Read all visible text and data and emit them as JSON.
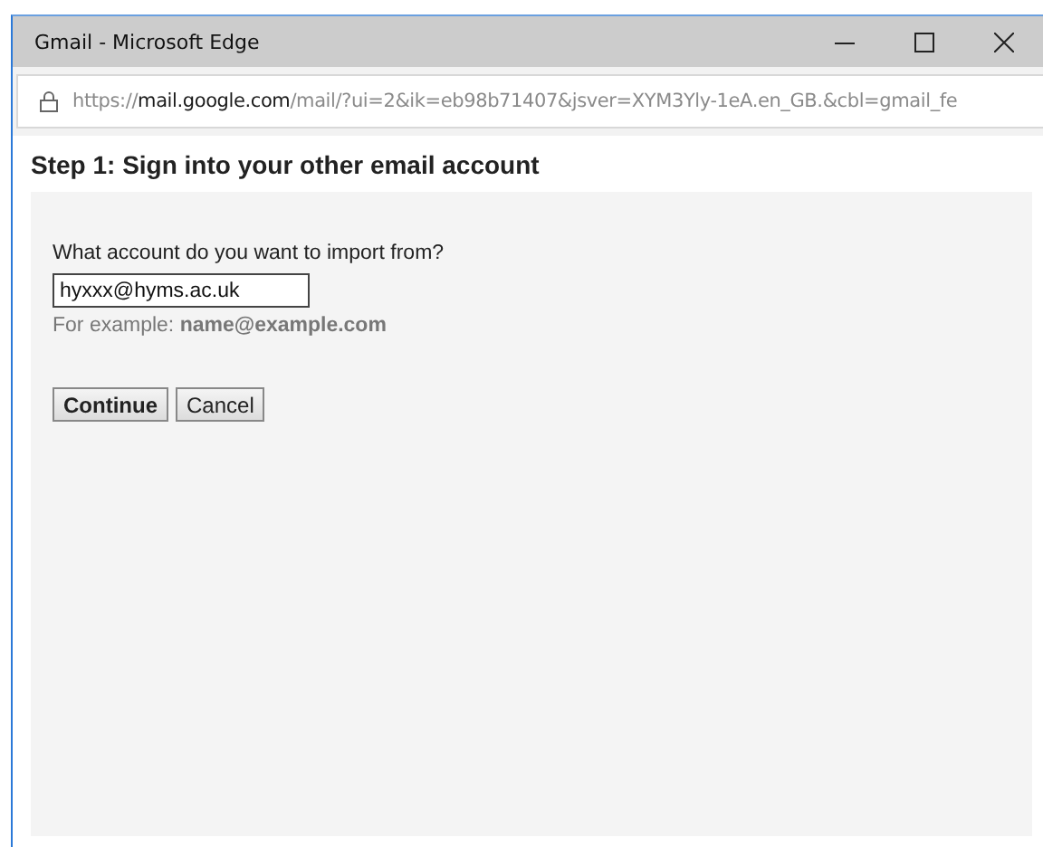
{
  "window": {
    "title": "Gmail - Microsoft Edge"
  },
  "address_bar": {
    "scheme": "https://",
    "host": "mail.google.com",
    "path": "/mail/?ui=2&ik=eb98b71407&jsver=XYM3Yly-1eA.en_GB.&cbl=gmail_fe"
  },
  "heading": "Step 1: Sign into your other email account",
  "form": {
    "label": "What account do you want to import from?",
    "value": "hyxxx@hyms.ac.uk",
    "hint": "For example: **name@example.com**"
  },
  "buttons": [
    {
      "label": "Continue",
      "kind": "primary"
    },
    {
      "label": "Cancel",
      "kind": "secondary"
    }
  ]
}
